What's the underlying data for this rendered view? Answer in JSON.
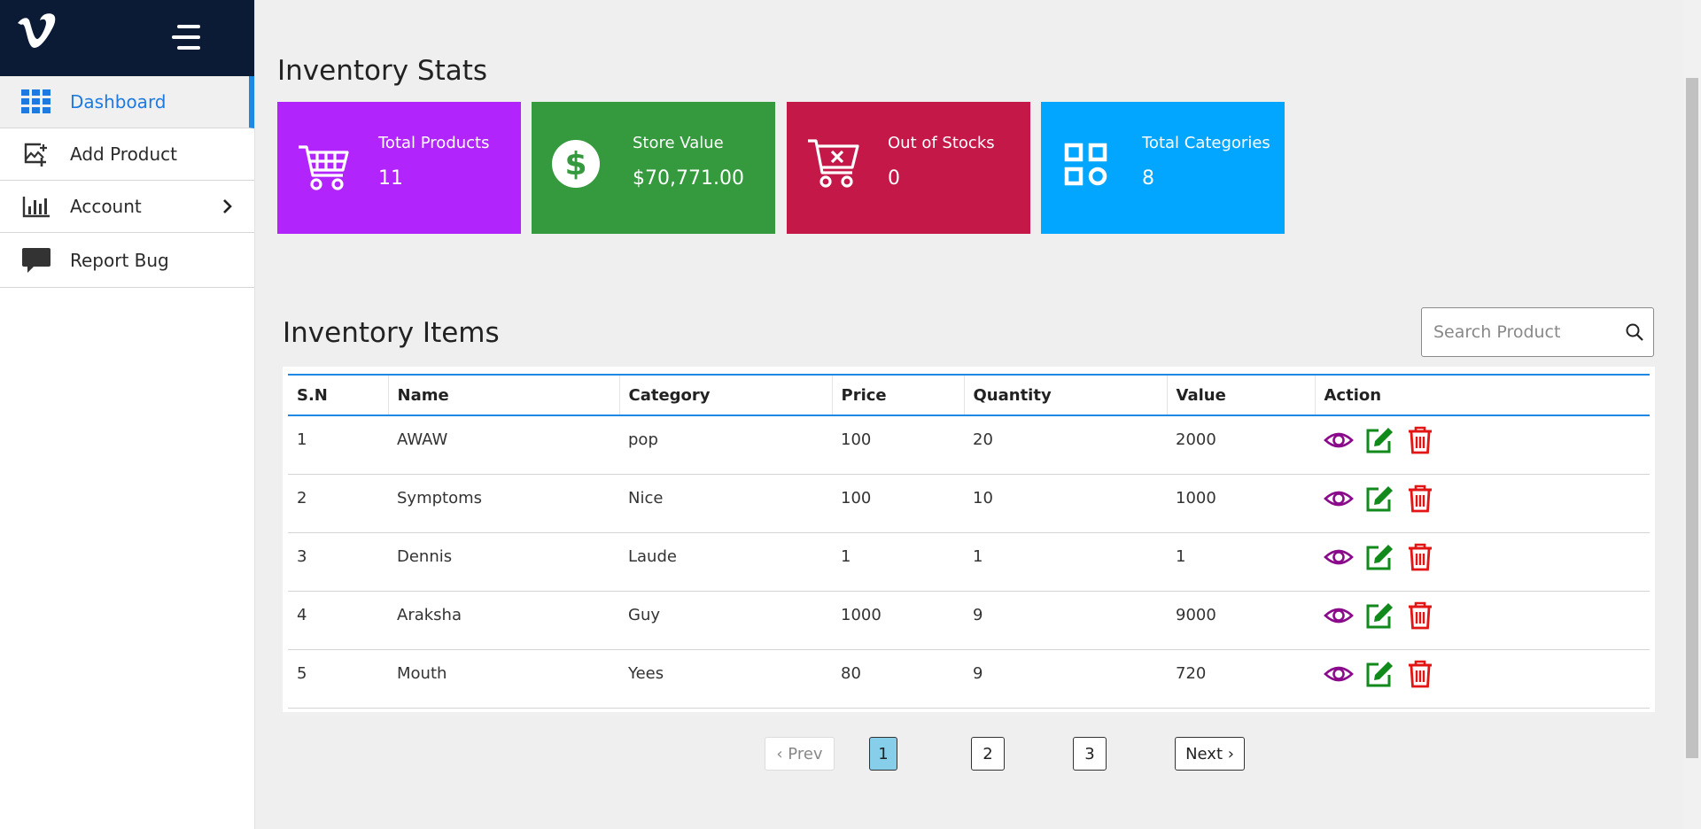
{
  "sidebar": {
    "items": [
      {
        "label": "Dashboard",
        "icon": "grid-icon"
      },
      {
        "label": "Add Product",
        "icon": "add-image-icon"
      },
      {
        "label": "Account",
        "icon": "bar-chart-icon"
      },
      {
        "label": "Report Bug",
        "icon": "chat-bubble-icon"
      }
    ]
  },
  "stats": {
    "title": "Inventory Stats",
    "cards": [
      {
        "label": "Total Products",
        "value": "11",
        "color": "#b224fc",
        "icon": "cart-icon"
      },
      {
        "label": "Store Value",
        "value": "$70,771.00",
        "color": "#349a3d",
        "icon": "dollar-icon"
      },
      {
        "label": "Out of Stocks",
        "value": "0",
        "color": "#c41848",
        "icon": "cart-remove-icon"
      },
      {
        "label": "Total Categories",
        "value": "8",
        "color": "#03a6ff",
        "icon": "categories-icon"
      }
    ]
  },
  "inventory": {
    "title": "Inventory Items",
    "search_placeholder": "Search Product",
    "columns": [
      "S.N",
      "Name",
      "Category",
      "Price",
      "Quantity",
      "Value",
      "Action"
    ],
    "rows": [
      {
        "sn": "1",
        "name": "AWAW",
        "category": "pop",
        "price": "100",
        "quantity": "20",
        "value": "2000"
      },
      {
        "sn": "2",
        "name": "Symptoms",
        "category": "Nice",
        "price": "100",
        "quantity": "10",
        "value": "1000"
      },
      {
        "sn": "3",
        "name": "Dennis",
        "category": "Laude",
        "price": "1",
        "quantity": "1",
        "value": "1"
      },
      {
        "sn": "4",
        "name": "Araksha",
        "category": "Guy",
        "price": "1000",
        "quantity": "9",
        "value": "9000"
      },
      {
        "sn": "5",
        "name": "Mouth",
        "category": "Yees",
        "price": "80",
        "quantity": "9",
        "value": "720"
      }
    ]
  },
  "pagination": {
    "prev": "‹ Prev",
    "next": "Next ›",
    "pages": [
      "1",
      "2",
      "3"
    ],
    "current": "1"
  },
  "colors": {
    "sidebar_header": "#0b1a35",
    "accent": "#1e88e5",
    "view": "#8b0a8b",
    "edit": "#118a1b",
    "delete": "#e31414"
  }
}
